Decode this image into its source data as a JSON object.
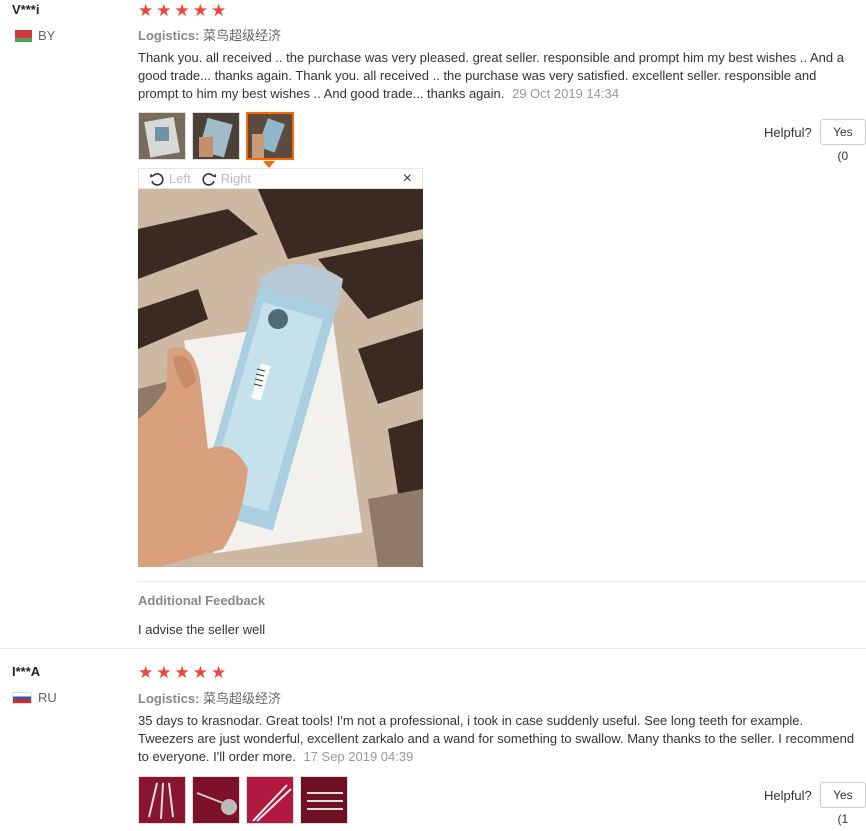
{
  "reviews": [
    {
      "user": "V***i",
      "country": "BY",
      "rating": 5,
      "logistics_label": "Logistics:",
      "logistics_value": "菜鸟超级经济",
      "text": "Thank you. all received .. the purchase was very pleased. great seller. responsible and prompt him my best wishes .. And a good trade... thanks again. Thank you. all received .. the purchase was very satisfied. excellent seller. responsible and prompt to him my best wishes .. And good trade... thanks again.",
      "date": "29 Oct 2019 14:34",
      "helpful_label": "Helpful?",
      "yes_label": "Yes (0",
      "viewer": {
        "rotate_left": "Left",
        "rotate_right": "Right",
        "close": "×"
      },
      "additional_title": "Additional Feedback",
      "additional_text": "I advise the seller well"
    },
    {
      "user": "I***A",
      "country": "RU",
      "rating": 5,
      "logistics_label": "Logistics:",
      "logistics_value": "菜鸟超级经济",
      "text": "35 days to krasnodar. Great tools! I'm not a professional, i took in case suddenly useful. See long teeth for example. Tweezers are just wonderful, excellent zarkalo and a wand for something to swallow. Many thanks to the seller. I recommend to everyone. I'll order more.",
      "date": "17 Sep 2019 04:39",
      "helpful_label": "Helpful?",
      "yes_label": "Yes (1"
    }
  ],
  "colors": {
    "star": "#f0453a",
    "accent": "#ff6a00"
  }
}
